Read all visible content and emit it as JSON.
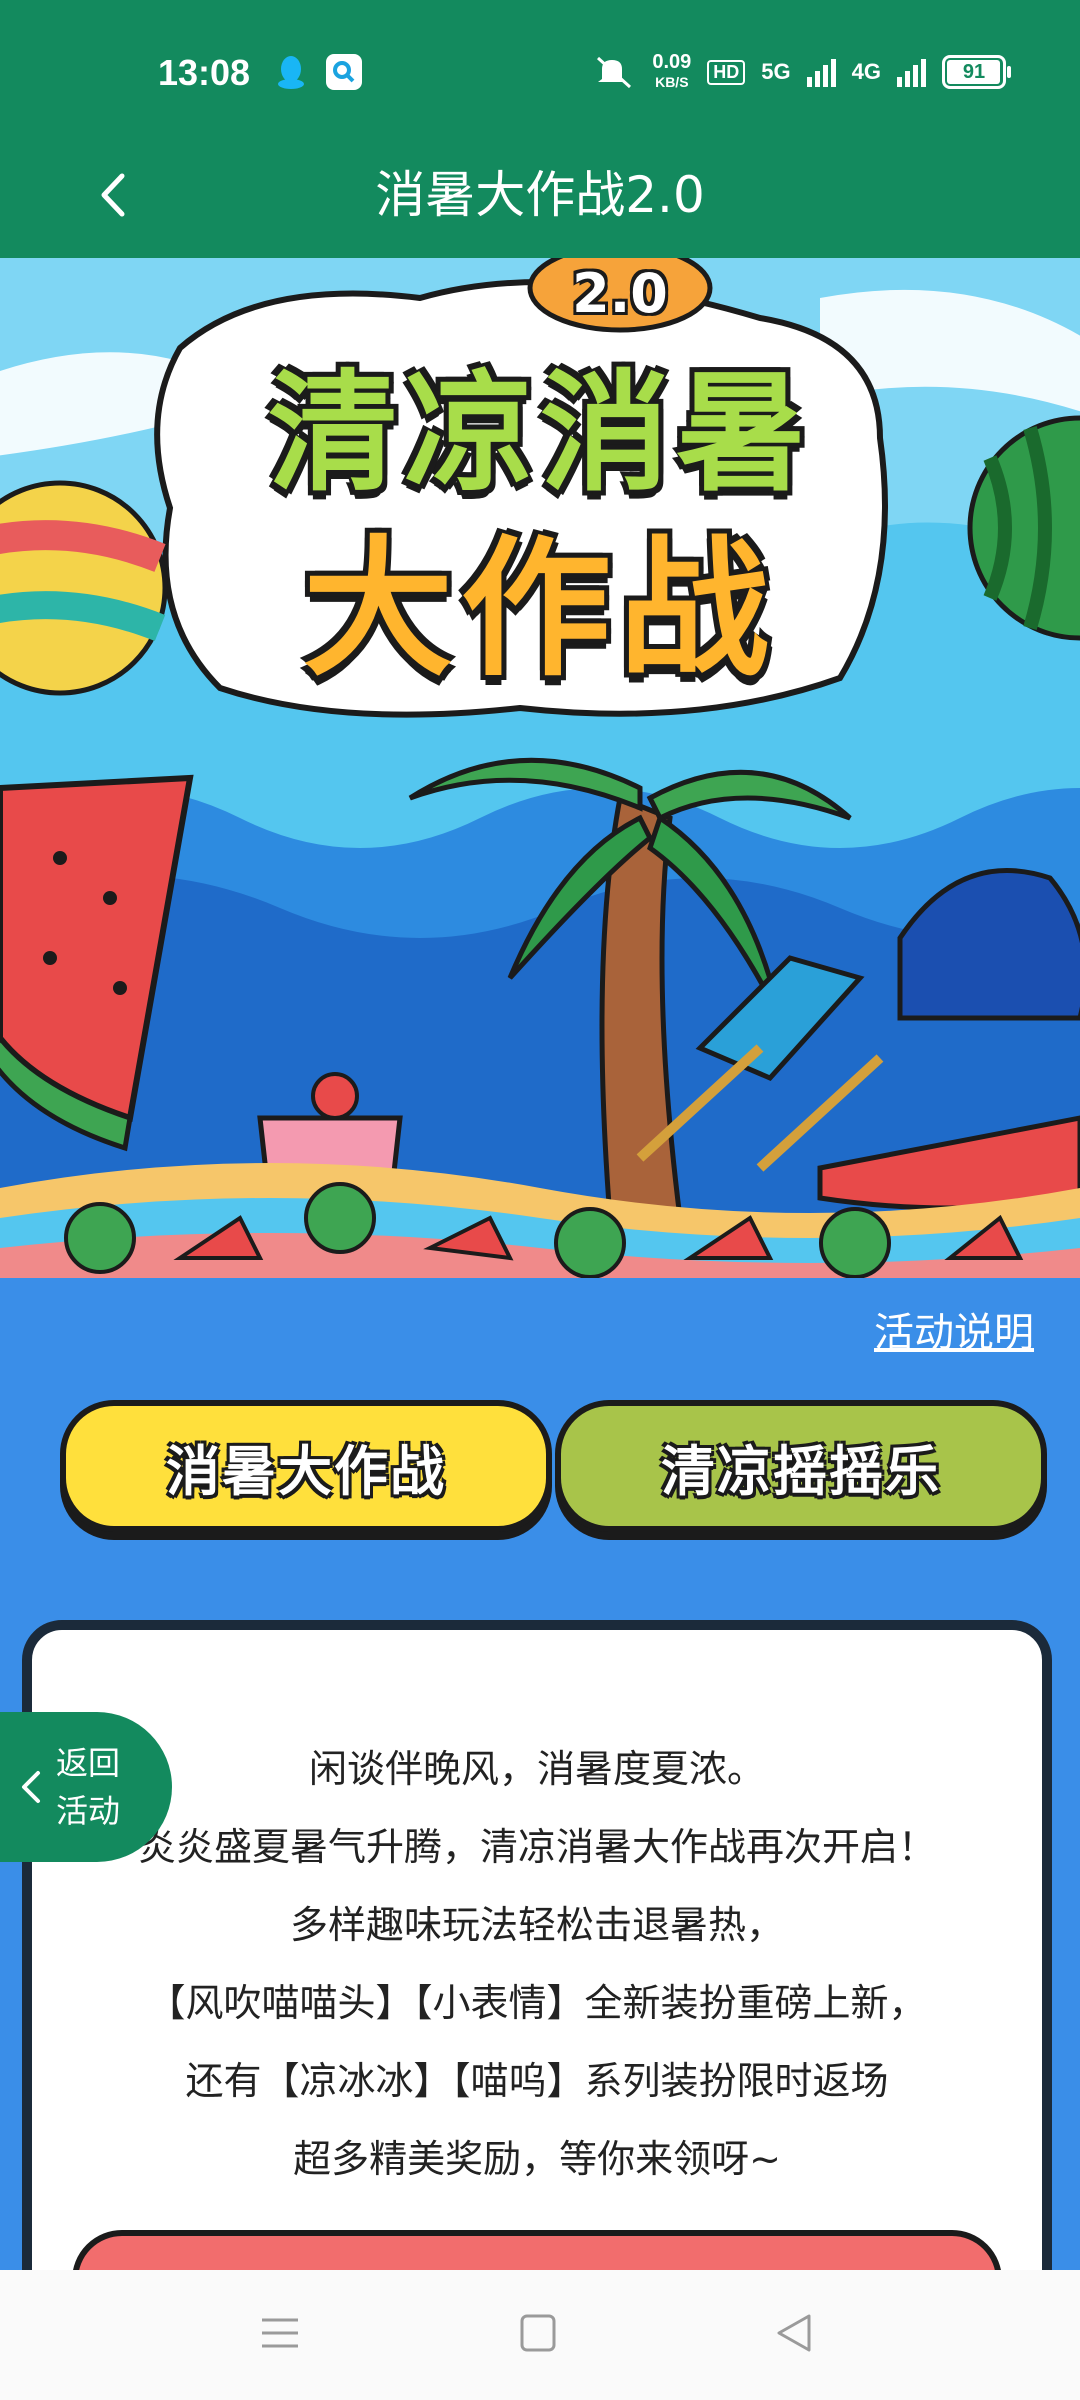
{
  "status_bar": {
    "time": "13:08",
    "net_speed_value": "0.09",
    "net_speed_unit": "KB/S",
    "hd_label": "HD",
    "network_1": "5G",
    "network_2": "4G",
    "battery": "91",
    "battery_level": 0.91
  },
  "header": {
    "title": "消暑大作战2.0"
  },
  "banner": {
    "badge": "2.0",
    "title_line1": "清凉消暑",
    "title_line2": "大作战"
  },
  "explain_link": "活动说明",
  "tabs": [
    {
      "label": "消暑大作战",
      "color": "#ffe03c"
    },
    {
      "label": "清凉摇摇乐",
      "color": "#a8c44a"
    }
  ],
  "intro_lines": [
    "闲谈伴晚风，消暑度夏浓。",
    "炎炎盛夏暑气升腾，清凉消暑大作战再次开启！",
    "多样趣味玩法轻松击退暑热，",
    "【风吹喵喵头】【小表情】全新装扮重磅上新，",
    "还有【凉冰冰】【喵呜】系列装扮限时返场",
    "超多精美奖励，等你来领呀~"
  ],
  "float_back": {
    "line1": "返回",
    "line2": "活动"
  },
  "colors": {
    "header_green": "#138a5e",
    "page_blue": "#3a8ee8",
    "card_border": "#1b2a3a"
  }
}
